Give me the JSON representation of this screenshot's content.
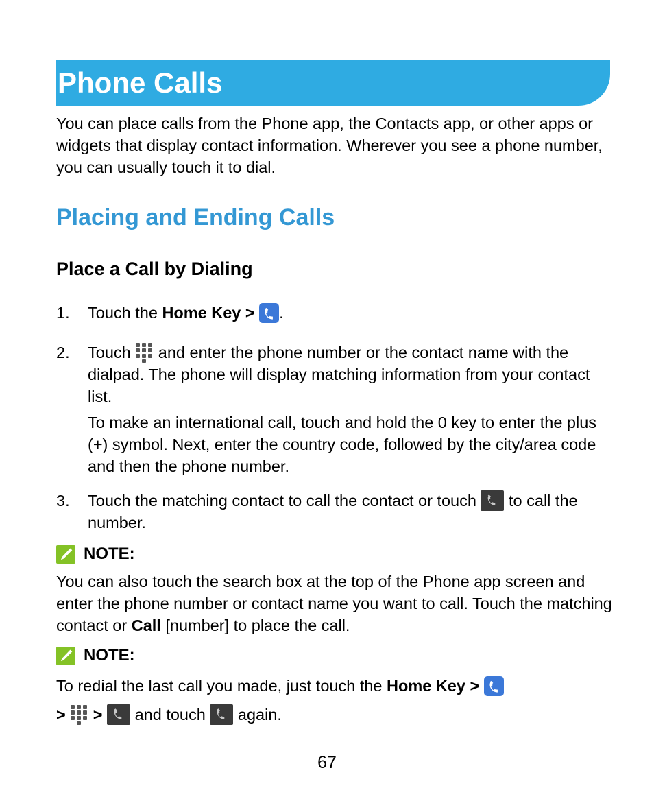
{
  "document": {
    "banner_title": "Phone Calls",
    "banner_color": "#2FABE2",
    "heading_color": "#3498D4",
    "note_badge_color": "#84C226",
    "phone_icon_blue_color": "#3B78D8",
    "phone_icon_dark_color": "#3A3A3A",
    "page_number": "67"
  },
  "intro": {
    "text": "You can place calls from the Phone app, the Contacts app, or other apps or widgets that display contact information. Wherever you see a phone number, you can usually touch it to dial."
  },
  "section": {
    "heading": "Placing and Ending Calls",
    "subheading": "Place a Call by Dialing"
  },
  "steps": [
    {
      "number": "1.",
      "text_before": "Touch the ",
      "bold": "Home Key >",
      "icon": "phone-app-icon",
      "text_after": "."
    },
    {
      "number": "2.",
      "text_before": "Touch ",
      "icon": "dialpad-icon",
      "text_after": " and enter the phone number or the contact name with the dialpad. The phone will display matching information from your contact list.",
      "paragraph2": "To make an international call, touch and hold the 0 key to enter the plus (+) symbol. Next, enter the country code, followed by the city/area code and then the phone number."
    },
    {
      "number": "3.",
      "text_before": "Touch the matching contact to call the contact or touch ",
      "icon": "call-button-icon",
      "text_after": " to call the number."
    }
  ],
  "notes": [
    {
      "label": "NOTE:",
      "icon": "note-pencil-icon",
      "body_part1": "You can also touch the search box at the top of the Phone app screen and enter the phone number or contact name you want to call. Touch the matching contact or ",
      "body_bold": "Call",
      "body_part2": " [number] to place the call."
    },
    {
      "label": "NOTE:",
      "icon": "note-pencil-icon",
      "body_part1": "To redial the last call you made, just touch the ",
      "body_bold": "Home Key >",
      "icon_1": "phone-app-icon",
      "sep_1": ">",
      "icon_2": "dialpad-icon",
      "sep_2": ">",
      "icon_3": "call-button-icon",
      "mid_text": " and touch ",
      "icon_4": "call-button-icon",
      "end_text": " again."
    }
  ]
}
